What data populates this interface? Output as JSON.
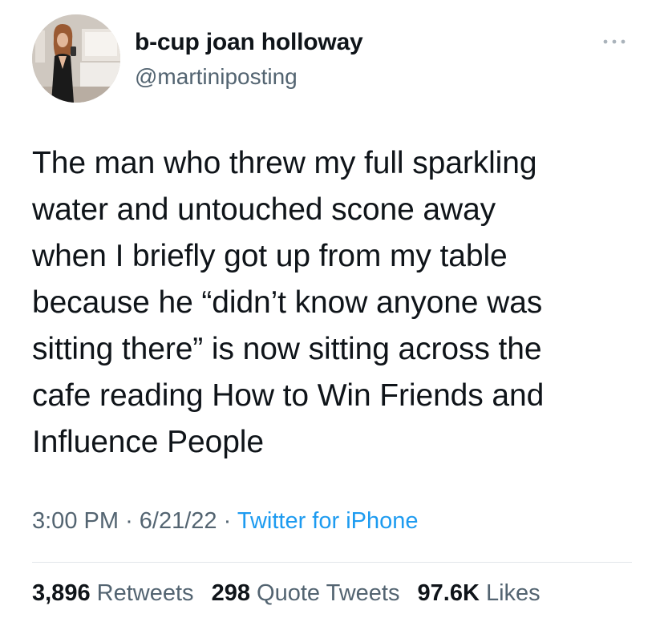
{
  "author": {
    "display_name": "b-cup joan holloway",
    "handle": "@martiniposting",
    "avatar_icon": "profile-photo"
  },
  "more_icon": "ellipsis-icon",
  "tweet": {
    "text": "The man who threw my full sparkling\nwater and untouched scone away\nwhen I briefly got up from my table\nbecause he “didn’t know anyone was\nsitting there” is now sitting across the\ncafe reading How to Win Friends and\nInfluence People"
  },
  "meta": {
    "time": "3:00 PM",
    "date": "6/21/22",
    "separator": "·",
    "source": "Twitter for iPhone"
  },
  "stats": {
    "retweets_count": "3,896",
    "retweets_label": "Retweets",
    "quotes_count": "298",
    "quotes_label": "Quote Tweets",
    "likes_count": "97.6K",
    "likes_label": "Likes"
  },
  "colors": {
    "text": "#0f1419",
    "secondary": "#536471",
    "link": "#1d9bf0",
    "divider": "#e1e6ea"
  }
}
